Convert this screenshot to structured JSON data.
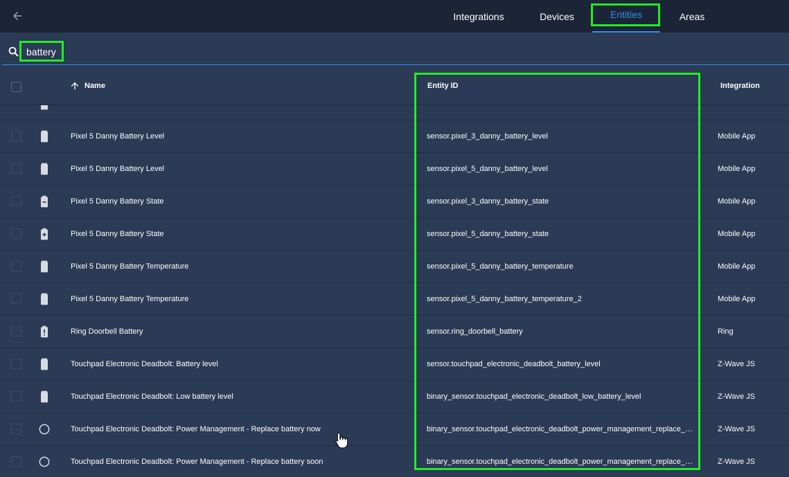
{
  "nav": {
    "tabs": [
      {
        "label": "Integrations",
        "active": false
      },
      {
        "label": "Devices",
        "active": false
      },
      {
        "label": "Entities",
        "active": true
      },
      {
        "label": "Areas",
        "active": false
      }
    ]
  },
  "search": {
    "value": "battery"
  },
  "table": {
    "columns": {
      "name": "Name",
      "entity_id": "Entity ID",
      "integration": "Integration"
    },
    "sort": "name-ascending",
    "rows": [
      {
        "icon": "battery-icon",
        "name": "Pixel 5 Danny Battery Level",
        "entity_id": "sensor.pixel_3_danny_battery_level",
        "integration": "Mobile App"
      },
      {
        "icon": "battery-icon",
        "name": "Pixel 5 Danny Battery Level",
        "entity_id": "sensor.pixel_5_danny_battery_level",
        "integration": "Mobile App"
      },
      {
        "icon": "battery-minus-icon",
        "name": "Pixel 5 Danny Battery State",
        "entity_id": "sensor.pixel_3_danny_battery_state",
        "integration": "Mobile App"
      },
      {
        "icon": "battery-plus-icon",
        "name": "Pixel 5 Danny Battery State",
        "entity_id": "sensor.pixel_5_danny_battery_state",
        "integration": "Mobile App"
      },
      {
        "icon": "battery-icon",
        "name": "Pixel 5 Danny Battery Temperature",
        "entity_id": "sensor.pixel_5_danny_battery_temperature",
        "integration": "Mobile App"
      },
      {
        "icon": "battery-icon",
        "name": "Pixel 5 Danny Battery Temperature",
        "entity_id": "sensor.pixel_5_danny_battery_temperature_2",
        "integration": "Mobile App"
      },
      {
        "icon": "battery-alert-icon",
        "name": "Ring Doorbell Battery",
        "entity_id": "sensor.ring_doorbell_battery",
        "integration": "Ring"
      },
      {
        "icon": "battery-icon",
        "name": "Touchpad Electronic Deadbolt: Battery level",
        "entity_id": "sensor.touchpad_electronic_deadbolt_battery_level",
        "integration": "Z-Wave JS"
      },
      {
        "icon": "battery-icon",
        "name": "Touchpad Electronic Deadbolt: Low battery level",
        "entity_id": "binary_sensor.touchpad_electronic_deadbolt_low_battery_level",
        "integration": "Z-Wave JS"
      },
      {
        "icon": "circle-outline-icon",
        "name": "Touchpad Electronic Deadbolt: Power Management - Replace battery now",
        "entity_id": "binary_sensor.touchpad_electronic_deadbolt_power_management_replace_…",
        "integration": "Z-Wave JS"
      },
      {
        "icon": "circle-outline-icon",
        "name": "Touchpad Electronic Deadbolt: Power Management - Replace battery soon",
        "entity_id": "binary_sensor.touchpad_electronic_deadbolt_power_management_replace_…",
        "integration": "Z-Wave JS"
      }
    ]
  },
  "colors": {
    "accent": "#2c8fe8",
    "highlight": "#22ee22",
    "background": "#2b3a55",
    "topbar": "#1c2538"
  }
}
